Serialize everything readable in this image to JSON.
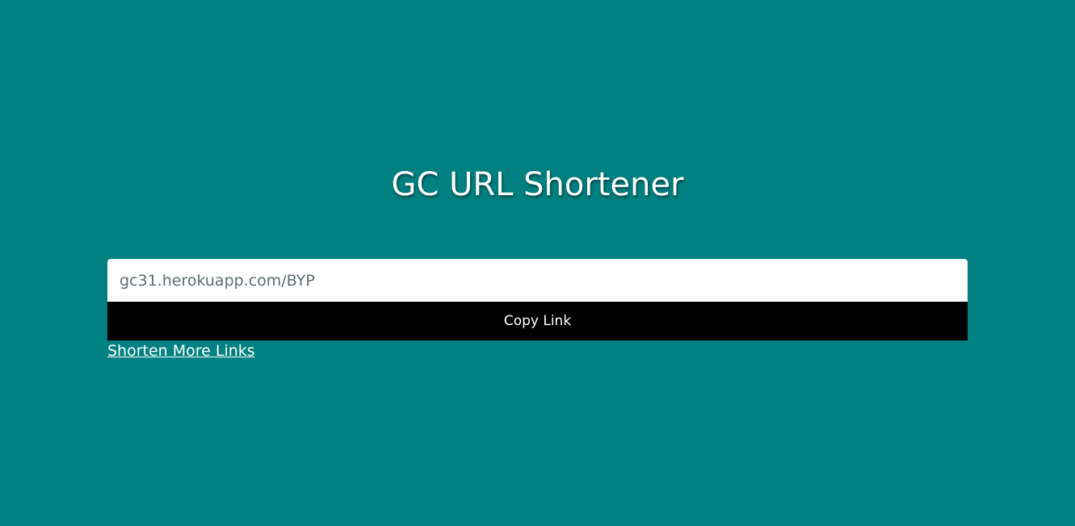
{
  "header": {
    "title": "GC URL Shortener"
  },
  "result": {
    "short_url": "gc31.herokuapp.com/BYP",
    "copy_label": "Copy Link",
    "more_link_label": "Shorten More Links"
  },
  "colors": {
    "background": "#008080",
    "button_bg": "#000000",
    "text": "#ffffff"
  }
}
